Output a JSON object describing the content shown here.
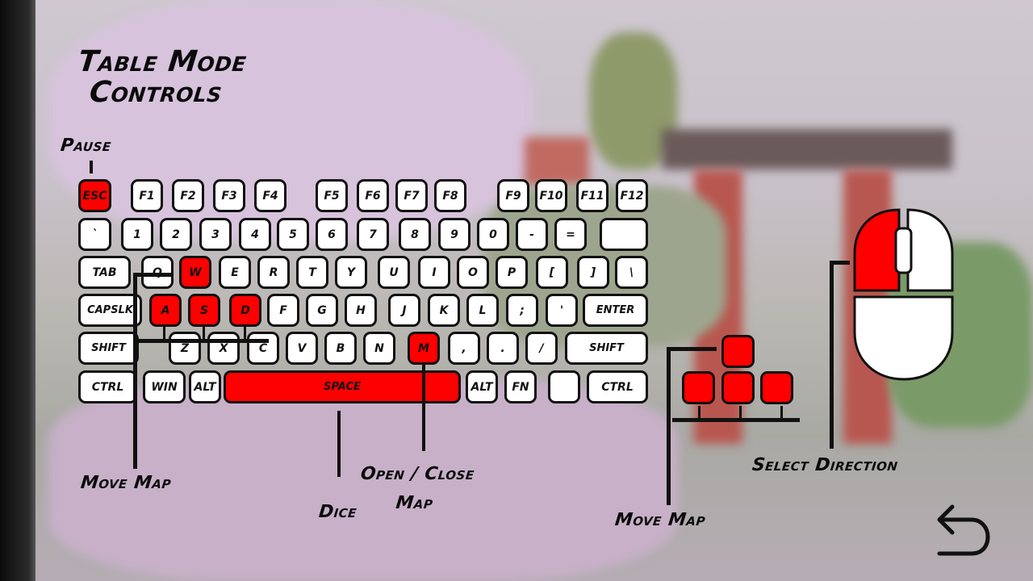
{
  "title_line1": "Table Mode",
  "title_line2": "Controls",
  "labels": {
    "pause": "Pause",
    "move_map_left": "Move Map",
    "dice": "Dice",
    "open_close_1": "Open / Close",
    "open_close_2": "Map",
    "move_map_right": "Move Map",
    "select_direction": "Select Direction"
  },
  "keyboard": {
    "rows": [
      [
        {
          "k": "ESC",
          "hl": true
        },
        {
          "k": "F1"
        },
        {
          "k": "F2"
        },
        {
          "k": "F3"
        },
        {
          "k": "F4"
        },
        {
          "k": "F5"
        },
        {
          "k": "F6"
        },
        {
          "k": "F7"
        },
        {
          "k": "F8"
        },
        {
          "k": "F9"
        },
        {
          "k": "F10"
        },
        {
          "k": "F11"
        },
        {
          "k": "F12"
        }
      ],
      [
        {
          "k": "`"
        },
        {
          "k": "1"
        },
        {
          "k": "2"
        },
        {
          "k": "3"
        },
        {
          "k": "4"
        },
        {
          "k": "5"
        },
        {
          "k": "6"
        },
        {
          "k": "7"
        },
        {
          "k": "8"
        },
        {
          "k": "9"
        },
        {
          "k": "0"
        },
        {
          "k": "-"
        },
        {
          "k": "="
        },
        {
          "k": ""
        }
      ],
      [
        {
          "k": "TAB"
        },
        {
          "k": "Q"
        },
        {
          "k": "W",
          "hl": true
        },
        {
          "k": "E"
        },
        {
          "k": "R"
        },
        {
          "k": "T"
        },
        {
          "k": "Y"
        },
        {
          "k": "U"
        },
        {
          "k": "I"
        },
        {
          "k": "O"
        },
        {
          "k": "P"
        },
        {
          "k": "["
        },
        {
          "k": "]"
        },
        {
          "k": "\\"
        }
      ],
      [
        {
          "k": "CAPSLK"
        },
        {
          "k": "A",
          "hl": true
        },
        {
          "k": "S",
          "hl": true
        },
        {
          "k": "D",
          "hl": true
        },
        {
          "k": "F"
        },
        {
          "k": "G"
        },
        {
          "k": "H"
        },
        {
          "k": "J"
        },
        {
          "k": "K"
        },
        {
          "k": "L"
        },
        {
          "k": ";"
        },
        {
          "k": "'"
        },
        {
          "k": "ENTER"
        }
      ],
      [
        {
          "k": "SHIFT"
        },
        {
          "k": "Z"
        },
        {
          "k": "X"
        },
        {
          "k": "C"
        },
        {
          "k": "V"
        },
        {
          "k": "B"
        },
        {
          "k": "N"
        },
        {
          "k": "M",
          "hl": true
        },
        {
          "k": ","
        },
        {
          "k": "."
        },
        {
          "k": "/"
        },
        {
          "k": "SHIFT"
        }
      ],
      [
        {
          "k": "CTRL"
        },
        {
          "k": "WIN"
        },
        {
          "k": "ALT"
        },
        {
          "k": "SPACE",
          "hl": true
        },
        {
          "k": "ALT"
        },
        {
          "k": "FN"
        },
        {
          "k": ""
        },
        {
          "k": "CTRL"
        }
      ]
    ]
  },
  "colors": {
    "highlight": "#ff0000"
  }
}
